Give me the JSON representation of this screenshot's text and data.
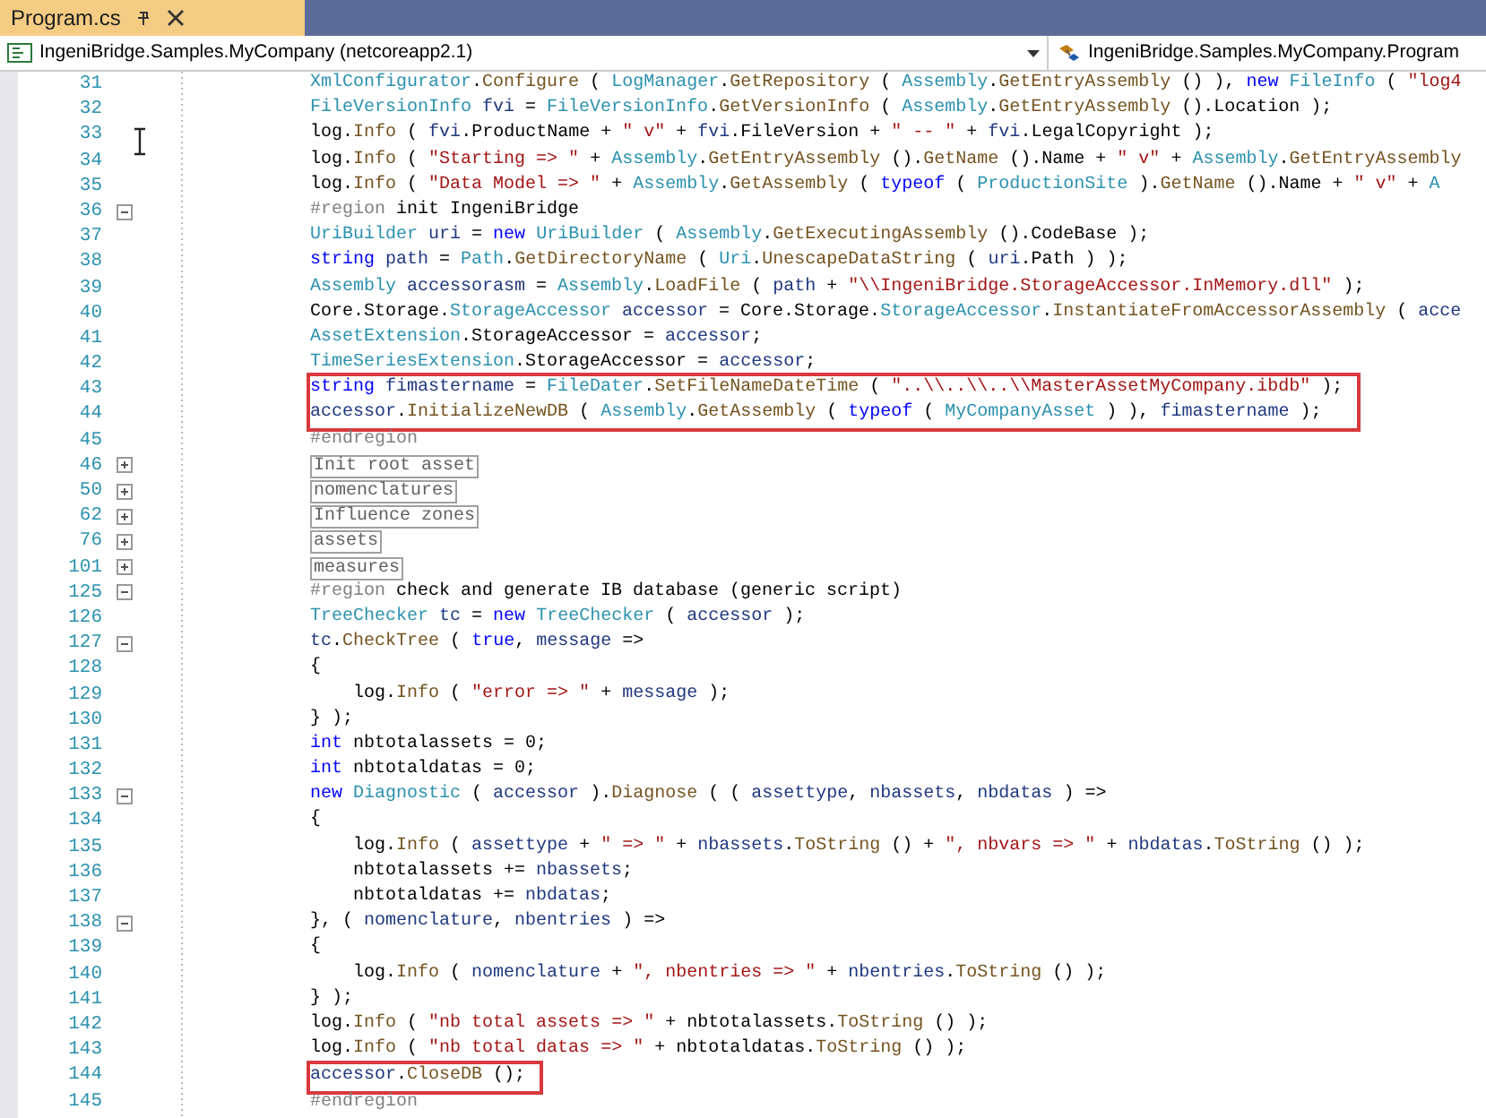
{
  "tab": {
    "title": "Program.cs",
    "selected": true
  },
  "navigation": {
    "project": "IngeniBridge.Samples.MyCompany (netcoreapp2.1)",
    "class": "IngeniBridge.Samples.MyCompany.Program"
  },
  "lines": [
    {
      "number": "31",
      "tokens": [
        {
          "kind": "type",
          "text": "XmlConfigurator"
        },
        {
          "kind": "plain",
          "text": "."
        },
        {
          "kind": "method",
          "text": "Configure"
        },
        {
          "kind": "plain",
          "text": " ( "
        },
        {
          "kind": "type",
          "text": "LogManager"
        },
        {
          "kind": "plain",
          "text": "."
        },
        {
          "kind": "method",
          "text": "GetRepository"
        },
        {
          "kind": "plain",
          "text": " ( "
        },
        {
          "kind": "type",
          "text": "Assembly"
        },
        {
          "kind": "plain",
          "text": "."
        },
        {
          "kind": "method",
          "text": "GetEntryAssembly"
        },
        {
          "kind": "plain",
          "text": " () ), "
        },
        {
          "kind": "kw",
          "text": "new"
        },
        {
          "kind": "type",
          "text": " FileInfo"
        },
        {
          "kind": "plain",
          "text": " ( "
        },
        {
          "kind": "str",
          "text": "\"log4"
        }
      ]
    },
    {
      "number": "32",
      "tokens": [
        {
          "kind": "type",
          "text": "FileVersionInfo"
        },
        {
          "kind": "var",
          "text": " fvi"
        },
        {
          "kind": "plain",
          "text": " = "
        },
        {
          "kind": "type",
          "text": "FileVersionInfo"
        },
        {
          "kind": "plain",
          "text": "."
        },
        {
          "kind": "method",
          "text": "GetVersionInfo"
        },
        {
          "kind": "plain",
          "text": " ( "
        },
        {
          "kind": "type",
          "text": "Assembly"
        },
        {
          "kind": "plain",
          "text": "."
        },
        {
          "kind": "method",
          "text": "GetEntryAssembly"
        },
        {
          "kind": "plain",
          "text": " ().Location );"
        }
      ]
    },
    {
      "number": "33",
      "tokens": [
        {
          "kind": "plain",
          "text": "log."
        },
        {
          "kind": "method",
          "text": "Info"
        },
        {
          "kind": "plain",
          "text": " ( "
        },
        {
          "kind": "var",
          "text": "fvi"
        },
        {
          "kind": "plain",
          "text": ".ProductName + "
        },
        {
          "kind": "str",
          "text": "\" v\""
        },
        {
          "kind": "plain",
          "text": " + "
        },
        {
          "kind": "var",
          "text": "fvi"
        },
        {
          "kind": "plain",
          "text": ".FileVersion + "
        },
        {
          "kind": "str",
          "text": "\" -- \""
        },
        {
          "kind": "plain",
          "text": " + "
        },
        {
          "kind": "var",
          "text": "fvi"
        },
        {
          "kind": "plain",
          "text": ".LegalCopyright );"
        }
      ]
    },
    {
      "number": "34",
      "tokens": [
        {
          "kind": "plain",
          "text": "log."
        },
        {
          "kind": "method",
          "text": "Info"
        },
        {
          "kind": "plain",
          "text": " ( "
        },
        {
          "kind": "str",
          "text": "\"Starting => \""
        },
        {
          "kind": "plain",
          "text": " + "
        },
        {
          "kind": "type",
          "text": "Assembly"
        },
        {
          "kind": "plain",
          "text": "."
        },
        {
          "kind": "method",
          "text": "GetEntryAssembly"
        },
        {
          "kind": "plain",
          "text": " ()."
        },
        {
          "kind": "method",
          "text": "GetName"
        },
        {
          "kind": "plain",
          "text": " ().Name + "
        },
        {
          "kind": "str",
          "text": "\" v\""
        },
        {
          "kind": "plain",
          "text": " + "
        },
        {
          "kind": "type",
          "text": "Assembly"
        },
        {
          "kind": "plain",
          "text": "."
        },
        {
          "kind": "method",
          "text": "GetEntryAssembly"
        }
      ]
    },
    {
      "number": "35",
      "tokens": [
        {
          "kind": "plain",
          "text": "log."
        },
        {
          "kind": "method",
          "text": "Info"
        },
        {
          "kind": "plain",
          "text": " ( "
        },
        {
          "kind": "str",
          "text": "\"Data Model => \""
        },
        {
          "kind": "plain",
          "text": " + "
        },
        {
          "kind": "type",
          "text": "Assembly"
        },
        {
          "kind": "plain",
          "text": "."
        },
        {
          "kind": "method",
          "text": "GetAssembly"
        },
        {
          "kind": "plain",
          "text": " ( "
        },
        {
          "kind": "kw",
          "text": "typeof"
        },
        {
          "kind": "plain",
          "text": " ( "
        },
        {
          "kind": "type",
          "text": "ProductionSite"
        },
        {
          "kind": "plain",
          "text": " )."
        },
        {
          "kind": "method",
          "text": "GetName"
        },
        {
          "kind": "plain",
          "text": " ().Name + "
        },
        {
          "kind": "str",
          "text": "\" v\""
        },
        {
          "kind": "plain",
          "text": " + "
        },
        {
          "kind": "type",
          "text": "A"
        }
      ]
    },
    {
      "number": "36",
      "expanded": true,
      "tokens": [
        {
          "kind": "pre",
          "text": "#region"
        },
        {
          "kind": "plain",
          "text": " init IngeniBridge"
        }
      ]
    },
    {
      "number": "37",
      "tokens": [
        {
          "kind": "type",
          "text": "UriBuilder"
        },
        {
          "kind": "var",
          "text": " uri"
        },
        {
          "kind": "plain",
          "text": " = "
        },
        {
          "kind": "kw",
          "text": "new"
        },
        {
          "kind": "type",
          "text": " UriBuilder"
        },
        {
          "kind": "plain",
          "text": " ( "
        },
        {
          "kind": "type",
          "text": "Assembly"
        },
        {
          "kind": "plain",
          "text": "."
        },
        {
          "kind": "method",
          "text": "GetExecutingAssembly"
        },
        {
          "kind": "plain",
          "text": " ().CodeBase );"
        }
      ]
    },
    {
      "number": "38",
      "tokens": [
        {
          "kind": "kw",
          "text": "string"
        },
        {
          "kind": "var",
          "text": " path"
        },
        {
          "kind": "plain",
          "text": " = "
        },
        {
          "kind": "type",
          "text": "Path"
        },
        {
          "kind": "plain",
          "text": "."
        },
        {
          "kind": "method",
          "text": "GetDirectoryName"
        },
        {
          "kind": "plain",
          "text": " ( "
        },
        {
          "kind": "type",
          "text": "Uri"
        },
        {
          "kind": "plain",
          "text": "."
        },
        {
          "kind": "method",
          "text": "UnescapeDataString"
        },
        {
          "kind": "plain",
          "text": " ( "
        },
        {
          "kind": "var",
          "text": "uri"
        },
        {
          "kind": "plain",
          "text": ".Path ) );"
        }
      ]
    },
    {
      "number": "39",
      "tokens": [
        {
          "kind": "type",
          "text": "Assembly"
        },
        {
          "kind": "var",
          "text": " accessorasm"
        },
        {
          "kind": "plain",
          "text": " = "
        },
        {
          "kind": "type",
          "text": "Assembly"
        },
        {
          "kind": "plain",
          "text": "."
        },
        {
          "kind": "method",
          "text": "LoadFile"
        },
        {
          "kind": "plain",
          "text": " ( "
        },
        {
          "kind": "var",
          "text": "path"
        },
        {
          "kind": "plain",
          "text": " + "
        },
        {
          "kind": "str",
          "text": "\"\\\\IngeniBridge.StorageAccessor.InMemory.dll\""
        },
        {
          "kind": "plain",
          "text": " );"
        }
      ]
    },
    {
      "number": "40",
      "tokens": [
        {
          "kind": "plain",
          "text": "Core.Storage."
        },
        {
          "kind": "type",
          "text": "StorageAccessor"
        },
        {
          "kind": "var",
          "text": " accessor"
        },
        {
          "kind": "plain",
          "text": " = Core.Storage."
        },
        {
          "kind": "type",
          "text": "StorageAccessor"
        },
        {
          "kind": "plain",
          "text": "."
        },
        {
          "kind": "method",
          "text": "InstantiateFromAccessorAssembly"
        },
        {
          "kind": "plain",
          "text": " ( "
        },
        {
          "kind": "var",
          "text": "acce"
        }
      ]
    },
    {
      "number": "41",
      "tokens": [
        {
          "kind": "type",
          "text": "AssetExtension"
        },
        {
          "kind": "plain",
          "text": ".StorageAccessor = "
        },
        {
          "kind": "var",
          "text": "accessor"
        },
        {
          "kind": "plain",
          "text": ";"
        }
      ]
    },
    {
      "number": "42",
      "tokens": [
        {
          "kind": "type",
          "text": "TimeSeriesExtension"
        },
        {
          "kind": "plain",
          "text": ".StorageAccessor = "
        },
        {
          "kind": "var",
          "text": "accessor"
        },
        {
          "kind": "plain",
          "text": ";"
        }
      ]
    },
    {
      "number": "43",
      "highlighted": true,
      "tokens": [
        {
          "kind": "kw",
          "text": "string"
        },
        {
          "kind": "var",
          "text": " fimastername"
        },
        {
          "kind": "plain",
          "text": " = "
        },
        {
          "kind": "type",
          "text": "FileDater"
        },
        {
          "kind": "plain",
          "text": "."
        },
        {
          "kind": "method",
          "text": "SetFileNameDateTime"
        },
        {
          "kind": "plain",
          "text": " ( "
        },
        {
          "kind": "str",
          "text": "\"..\\\\..\\\\..\\\\MasterAssetMyCompany.ibdb\""
        },
        {
          "kind": "plain",
          "text": " );"
        }
      ]
    },
    {
      "number": "44",
      "highlighted": true,
      "tokens": [
        {
          "kind": "var",
          "text": "accessor"
        },
        {
          "kind": "plain",
          "text": "."
        },
        {
          "kind": "method",
          "text": "InitializeNewDB"
        },
        {
          "kind": "plain",
          "text": " ( "
        },
        {
          "kind": "type",
          "text": "Assembly"
        },
        {
          "kind": "plain",
          "text": "."
        },
        {
          "kind": "method",
          "text": "GetAssembly"
        },
        {
          "kind": "plain",
          "text": " ( "
        },
        {
          "kind": "kw",
          "text": "typeof"
        },
        {
          "kind": "plain",
          "text": " ( "
        },
        {
          "kind": "type",
          "text": "MyCompanyAsset"
        },
        {
          "kind": "plain",
          "text": " ) ), "
        },
        {
          "kind": "var",
          "text": "fimastername"
        },
        {
          "kind": "plain",
          "text": " );"
        }
      ]
    },
    {
      "number": "45",
      "tokens": [
        {
          "kind": "pre",
          "text": "#endregion"
        }
      ]
    },
    {
      "number": "46",
      "expanded": false,
      "collapsed": "Init root asset"
    },
    {
      "number": "50",
      "expanded": false,
      "collapsed": "nomenclatures"
    },
    {
      "number": "62",
      "expanded": false,
      "collapsed": "Influence zones"
    },
    {
      "number": "76",
      "expanded": false,
      "collapsed": "assets"
    },
    {
      "number": "101",
      "expanded": false,
      "collapsed": "measures"
    },
    {
      "number": "125",
      "expanded": true,
      "tokens": [
        {
          "kind": "pre",
          "text": "#region"
        },
        {
          "kind": "plain",
          "text": " check and generate IB database (generic script)"
        }
      ]
    },
    {
      "number": "126",
      "tokens": [
        {
          "kind": "type",
          "text": "TreeChecker"
        },
        {
          "kind": "var",
          "text": " tc"
        },
        {
          "kind": "plain",
          "text": " = "
        },
        {
          "kind": "kw",
          "text": "new"
        },
        {
          "kind": "type",
          "text": " TreeChecker"
        },
        {
          "kind": "plain",
          "text": " ( "
        },
        {
          "kind": "var",
          "text": "accessor"
        },
        {
          "kind": "plain",
          "text": " );"
        }
      ]
    },
    {
      "number": "127",
      "expanded": true,
      "tokens": [
        {
          "kind": "var",
          "text": "tc"
        },
        {
          "kind": "plain",
          "text": "."
        },
        {
          "kind": "method",
          "text": "CheckTree"
        },
        {
          "kind": "plain",
          "text": " ( "
        },
        {
          "kind": "kw",
          "text": "true"
        },
        {
          "kind": "plain",
          "text": ", "
        },
        {
          "kind": "var",
          "text": "message"
        },
        {
          "kind": "plain",
          "text": " =>"
        }
      ]
    },
    {
      "number": "128",
      "tokens": [
        {
          "kind": "plain",
          "text": "{"
        }
      ]
    },
    {
      "number": "129",
      "tokens": [
        {
          "kind": "plain",
          "text": "    log."
        },
        {
          "kind": "method",
          "text": "Info"
        },
        {
          "kind": "plain",
          "text": " ( "
        },
        {
          "kind": "str",
          "text": "\"error => \""
        },
        {
          "kind": "plain",
          "text": " + "
        },
        {
          "kind": "var",
          "text": "message"
        },
        {
          "kind": "plain",
          "text": " );"
        }
      ]
    },
    {
      "number": "130",
      "tokens": [
        {
          "kind": "plain",
          "text": "} );"
        }
      ]
    },
    {
      "number": "131",
      "tokens": [
        {
          "kind": "kw",
          "text": "int"
        },
        {
          "kind": "plain",
          "text": " nbtotalassets = 0;"
        }
      ]
    },
    {
      "number": "132",
      "tokens": [
        {
          "kind": "kw",
          "text": "int"
        },
        {
          "kind": "plain",
          "text": " nbtotaldatas = 0;"
        }
      ]
    },
    {
      "number": "133",
      "expanded": true,
      "tokens": [
        {
          "kind": "kw",
          "text": "new"
        },
        {
          "kind": "type",
          "text": " Diagnostic"
        },
        {
          "kind": "plain",
          "text": " ( "
        },
        {
          "kind": "var",
          "text": "accessor"
        },
        {
          "kind": "plain",
          "text": " )."
        },
        {
          "kind": "method",
          "text": "Diagnose"
        },
        {
          "kind": "plain",
          "text": " ( ( "
        },
        {
          "kind": "var",
          "text": "assettype"
        },
        {
          "kind": "plain",
          "text": ", "
        },
        {
          "kind": "var",
          "text": "nbassets"
        },
        {
          "kind": "plain",
          "text": ", "
        },
        {
          "kind": "var",
          "text": "nbdatas"
        },
        {
          "kind": "plain",
          "text": " ) =>"
        }
      ]
    },
    {
      "number": "134",
      "tokens": [
        {
          "kind": "plain",
          "text": "{"
        }
      ]
    },
    {
      "number": "135",
      "tokens": [
        {
          "kind": "plain",
          "text": "    log."
        },
        {
          "kind": "method",
          "text": "Info"
        },
        {
          "kind": "plain",
          "text": " ( "
        },
        {
          "kind": "var",
          "text": "assettype"
        },
        {
          "kind": "plain",
          "text": " + "
        },
        {
          "kind": "str",
          "text": "\" => \""
        },
        {
          "kind": "plain",
          "text": " + "
        },
        {
          "kind": "var",
          "text": "nbassets"
        },
        {
          "kind": "plain",
          "text": "."
        },
        {
          "kind": "method",
          "text": "ToString"
        },
        {
          "kind": "plain",
          "text": " () + "
        },
        {
          "kind": "str",
          "text": "\", nbvars => \""
        },
        {
          "kind": "plain",
          "text": " + "
        },
        {
          "kind": "var",
          "text": "nbdatas"
        },
        {
          "kind": "plain",
          "text": "."
        },
        {
          "kind": "method",
          "text": "ToString"
        },
        {
          "kind": "plain",
          "text": " () );"
        }
      ]
    },
    {
      "number": "136",
      "tokens": [
        {
          "kind": "plain",
          "text": "    nbtotalassets += "
        },
        {
          "kind": "var",
          "text": "nbassets"
        },
        {
          "kind": "plain",
          "text": ";"
        }
      ]
    },
    {
      "number": "137",
      "tokens": [
        {
          "kind": "plain",
          "text": "    nbtotaldatas += "
        },
        {
          "kind": "var",
          "text": "nbdatas"
        },
        {
          "kind": "plain",
          "text": ";"
        }
      ]
    },
    {
      "number": "138",
      "expanded": true,
      "tokens": [
        {
          "kind": "plain",
          "text": "}, ( "
        },
        {
          "kind": "var",
          "text": "nomenclature"
        },
        {
          "kind": "plain",
          "text": ", "
        },
        {
          "kind": "var",
          "text": "nbentries"
        },
        {
          "kind": "plain",
          "text": " ) =>"
        }
      ]
    },
    {
      "number": "139",
      "tokens": [
        {
          "kind": "plain",
          "text": "{"
        }
      ]
    },
    {
      "number": "140",
      "tokens": [
        {
          "kind": "plain",
          "text": "    log."
        },
        {
          "kind": "method",
          "text": "Info"
        },
        {
          "kind": "plain",
          "text": " ( "
        },
        {
          "kind": "var",
          "text": "nomenclature"
        },
        {
          "kind": "plain",
          "text": " + "
        },
        {
          "kind": "str",
          "text": "\", nbentries => \""
        },
        {
          "kind": "plain",
          "text": " + "
        },
        {
          "kind": "var",
          "text": "nbentries"
        },
        {
          "kind": "plain",
          "text": "."
        },
        {
          "kind": "method",
          "text": "ToString"
        },
        {
          "kind": "plain",
          "text": " () );"
        }
      ]
    },
    {
      "number": "141",
      "tokens": [
        {
          "kind": "plain",
          "text": "} );"
        }
      ]
    },
    {
      "number": "142",
      "tokens": [
        {
          "kind": "plain",
          "text": "log."
        },
        {
          "kind": "method",
          "text": "Info"
        },
        {
          "kind": "plain",
          "text": " ( "
        },
        {
          "kind": "str",
          "text": "\"nb total assets => \""
        },
        {
          "kind": "plain",
          "text": " + nbtotalassets."
        },
        {
          "kind": "method",
          "text": "ToString"
        },
        {
          "kind": "plain",
          "text": " () );"
        }
      ]
    },
    {
      "number": "143",
      "tokens": [
        {
          "kind": "plain",
          "text": "log."
        },
        {
          "kind": "method",
          "text": "Info"
        },
        {
          "kind": "plain",
          "text": " ( "
        },
        {
          "kind": "str",
          "text": "\"nb total datas => \""
        },
        {
          "kind": "plain",
          "text": " + nbtotaldatas."
        },
        {
          "kind": "method",
          "text": "ToString"
        },
        {
          "kind": "plain",
          "text": " () );"
        }
      ]
    },
    {
      "number": "144",
      "highlighted": true,
      "tokens": [
        {
          "kind": "var",
          "text": "accessor"
        },
        {
          "kind": "plain",
          "text": "."
        },
        {
          "kind": "method",
          "text": "CloseDB"
        },
        {
          "kind": "plain",
          "text": " ();"
        }
      ]
    },
    {
      "number": "145",
      "tokens": [
        {
          "kind": "pre",
          "text": "#endregion"
        }
      ]
    }
  ]
}
